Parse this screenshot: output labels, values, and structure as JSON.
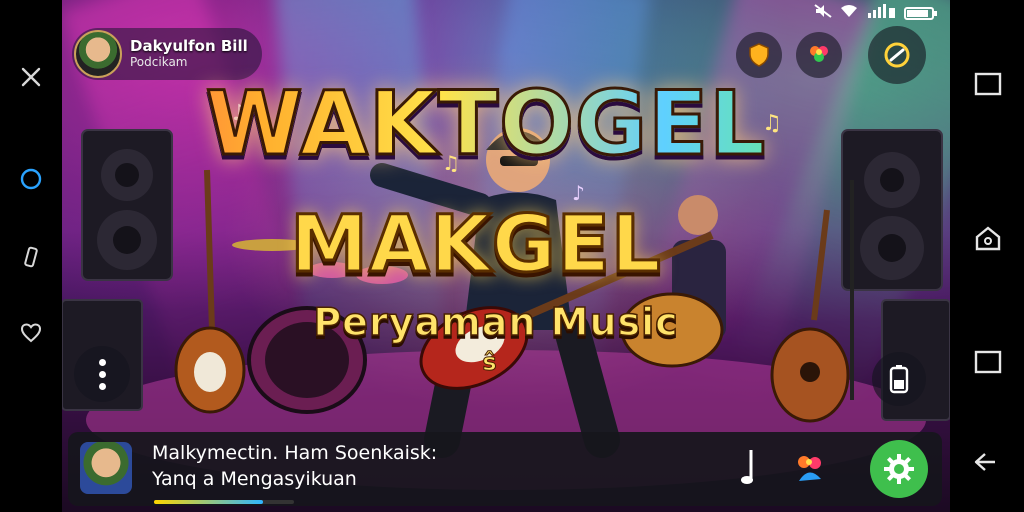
{
  "status": {
    "battery_level": 0.8,
    "icons": [
      "mute-icon",
      "wifi-icon",
      "signal-icon",
      "battery-icon"
    ]
  },
  "profile": {
    "name": "Dakyulfon Bill",
    "sub": "Podcikam"
  },
  "titles": {
    "main": "WAKTOGEL",
    "second": "MAKGEL",
    "third": "Peryaman Music",
    "fourth": "ŝ"
  },
  "bottom_panel": {
    "line1": "Malkymectin. Ham Soenkaisk:",
    "line2": "Yanq a Mengasyikuan",
    "progress": 0.78
  },
  "left_bar": {
    "icons": [
      "close-icon",
      "circle-icon",
      "rotate-icon",
      "heart-icon"
    ]
  },
  "right_bar": {
    "icons": [
      "square-icon",
      "home-icon",
      "square-icon",
      "back-icon"
    ]
  },
  "colors": {
    "accent_green": "#3fbf4d",
    "title_yellow": "#ffd84a"
  }
}
